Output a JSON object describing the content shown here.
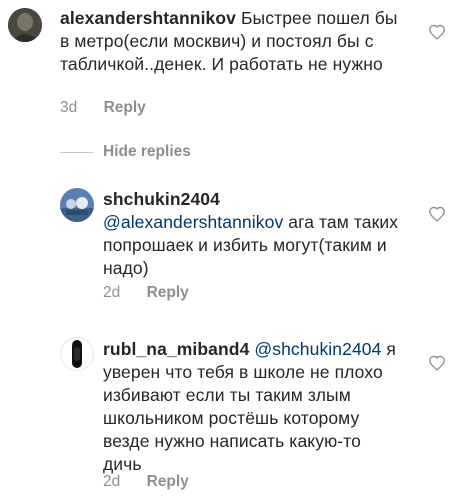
{
  "comments": [
    {
      "username": "alexandershtannikov",
      "mention": "",
      "text": "Быстрее пошел бы в метро(если москвич) и постоял бы с табличкой..денек. И работать не нужно",
      "time": "3d",
      "reply_label": "Reply"
    },
    {
      "username": "shchukin2404",
      "mention": "@alexandershtannikov",
      "text": "ага там таких попрошаек и избить могут(таким и надо)",
      "time": "2d",
      "reply_label": "Reply"
    },
    {
      "username": "rubl_na_miband4",
      "mention": "@shchukin2404",
      "text": "я уверен что тебя в школе не плохо избивают если ты таким злым школьником ростёшь которому везде нужно написать какую-то дичь",
      "time": "2d",
      "reply_label": "Reply"
    }
  ],
  "hide_replies_label": "Hide replies"
}
